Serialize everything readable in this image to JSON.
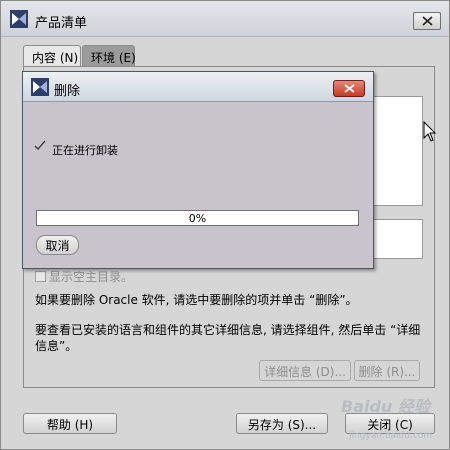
{
  "main_window": {
    "title": "产品清单",
    "tabs": [
      {
        "label": "内容 (N)",
        "active": true
      },
      {
        "label": "环境 (E)",
        "active": false
      }
    ],
    "show_empty_dirs_label": "显示空主目录。",
    "show_empty_dirs_checked": false,
    "instruction_delete": "如果要删除 Oracle 软件, 请选中要删除的项并单击 “删除”。",
    "instruction_details": "要查看已安装的语言和组件的其它详细信息, 请选择组件, 然后单击 “详细信息”。",
    "buttons": {
      "details": "详细信息 (D)...",
      "delete": "删除 (R)...",
      "help": "帮助 (H)",
      "save_as": "另存为 (S)...",
      "close": "关闭 (C)"
    }
  },
  "delete_dialog": {
    "title": "删除",
    "status": "正在进行卸装",
    "progress_text": "0%",
    "progress_fraction": 0,
    "cancel_label": "取消"
  },
  "watermark": {
    "text": "Baidu 经验",
    "sub": "jingyan.baidu.com"
  },
  "colors": {
    "progress_fill": "#3a5fa8",
    "dialog_bg": "#c8c3cd",
    "close_red": "#c43a25"
  }
}
